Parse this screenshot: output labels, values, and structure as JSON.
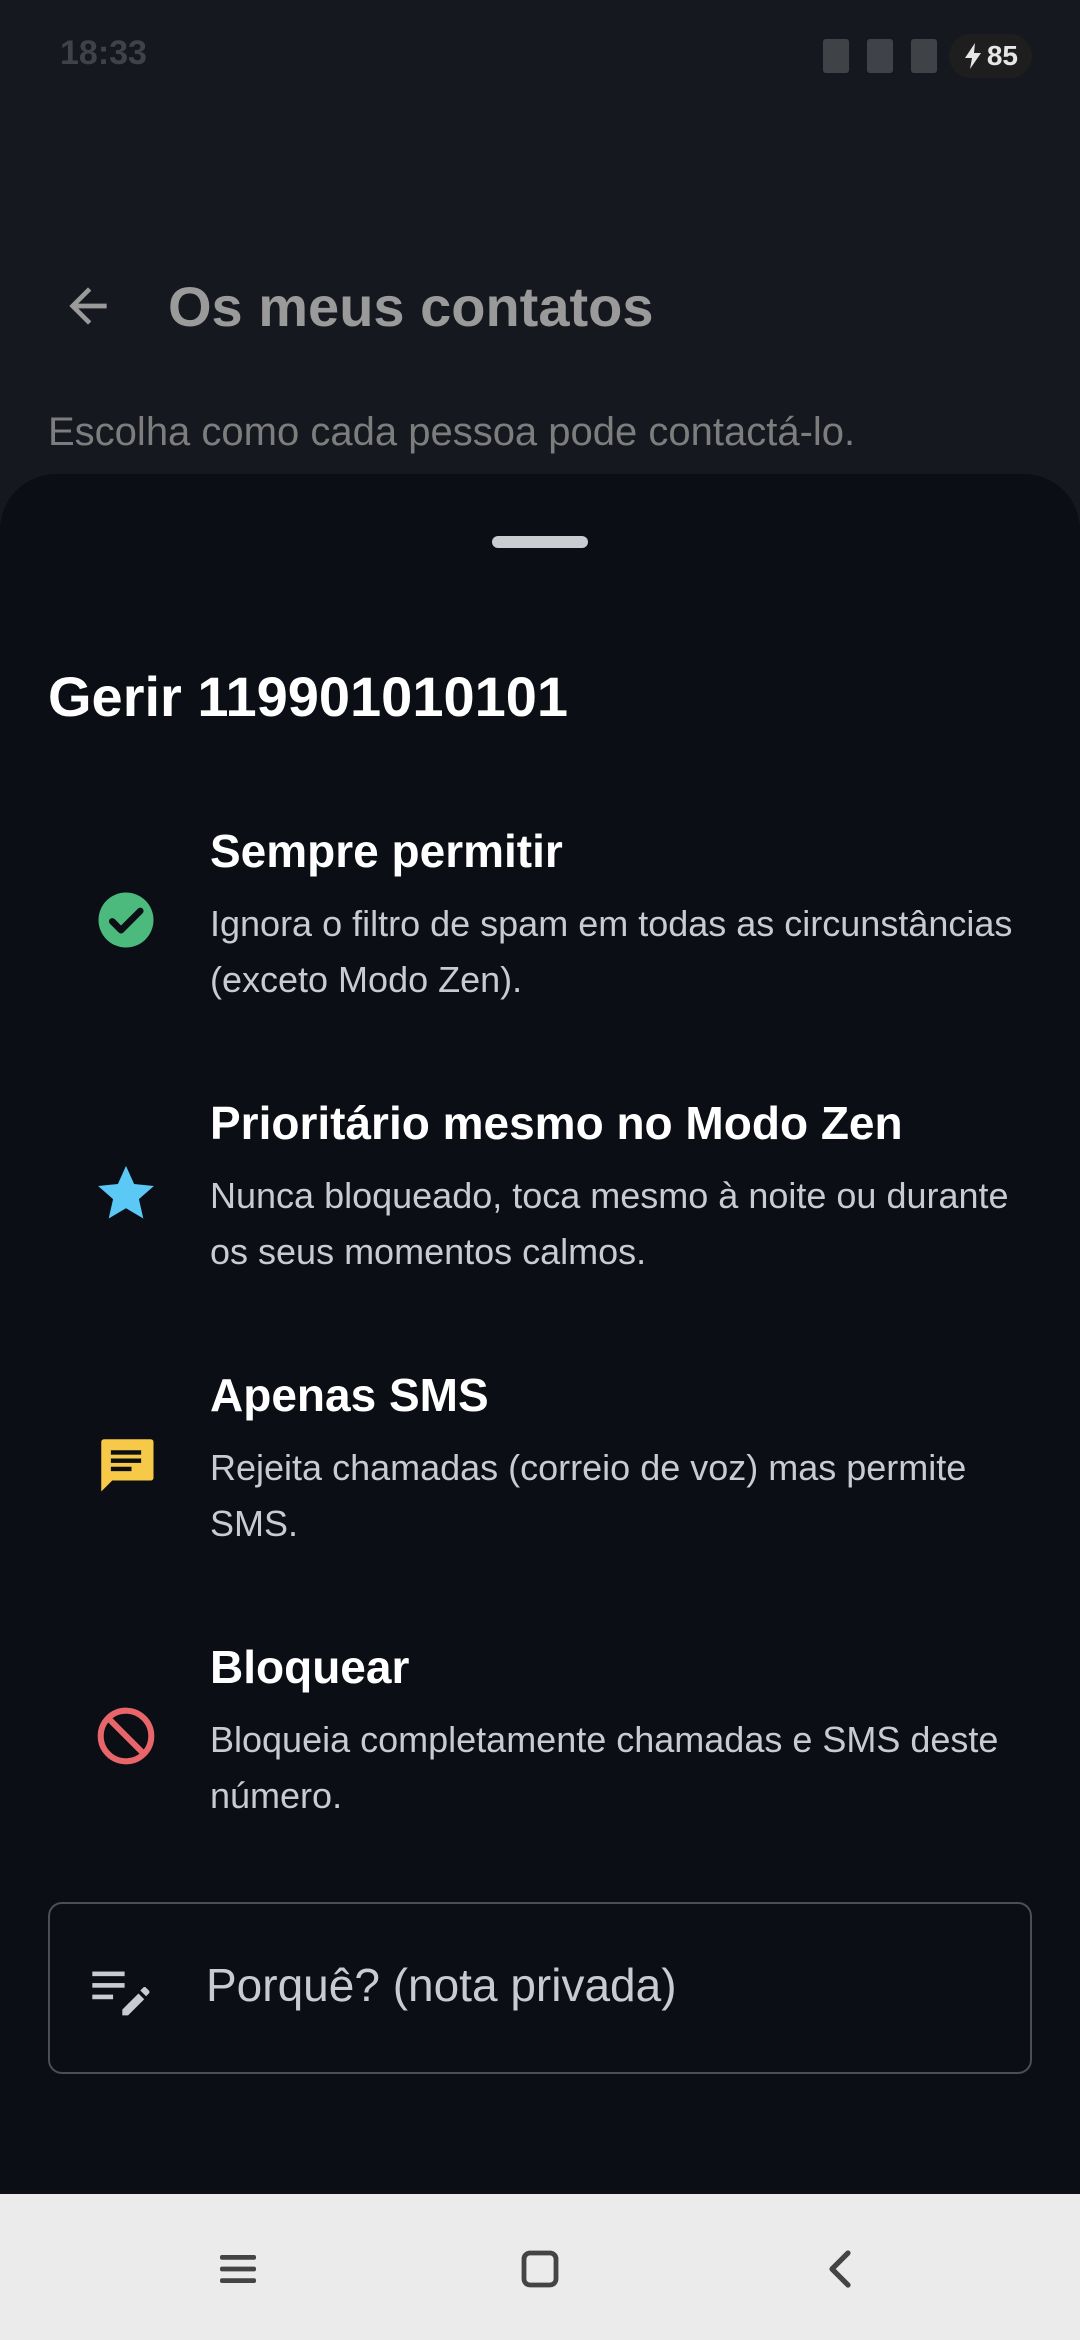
{
  "status_bar": {
    "time": "18:33",
    "battery_level": "85"
  },
  "header": {
    "title": "Os meus contatos",
    "subtitle": "Escolha como cada pessoa pode contactá-lo."
  },
  "sheet": {
    "title": "Gerir 119901010101",
    "options": [
      {
        "title": "Sempre permitir",
        "description": "Ignora o filtro de spam em todas as circunstâncias (exceto Modo Zen).",
        "icon": "check-circle-icon",
        "color": "#4cba7c"
      },
      {
        "title": "Prioritário mesmo no Modo Zen",
        "description": "Nunca bloqueado, toca mesmo à noite ou durante os seus momentos calmos.",
        "icon": "star-icon",
        "color": "#5bc8f5"
      },
      {
        "title": "Apenas SMS",
        "description": "Rejeita chamadas (correio de voz) mas permite SMS.",
        "icon": "message-icon",
        "color": "#f7c948"
      },
      {
        "title": "Bloquear",
        "description": "Bloqueia completamente chamadas e SMS deste número.",
        "icon": "block-icon",
        "color": "#e8666a"
      }
    ],
    "note_placeholder": "Porquê? (nota privada)"
  },
  "nav_bar": {
    "icons": [
      "menu-icon",
      "home-square-icon",
      "back-chevron-icon"
    ]
  }
}
